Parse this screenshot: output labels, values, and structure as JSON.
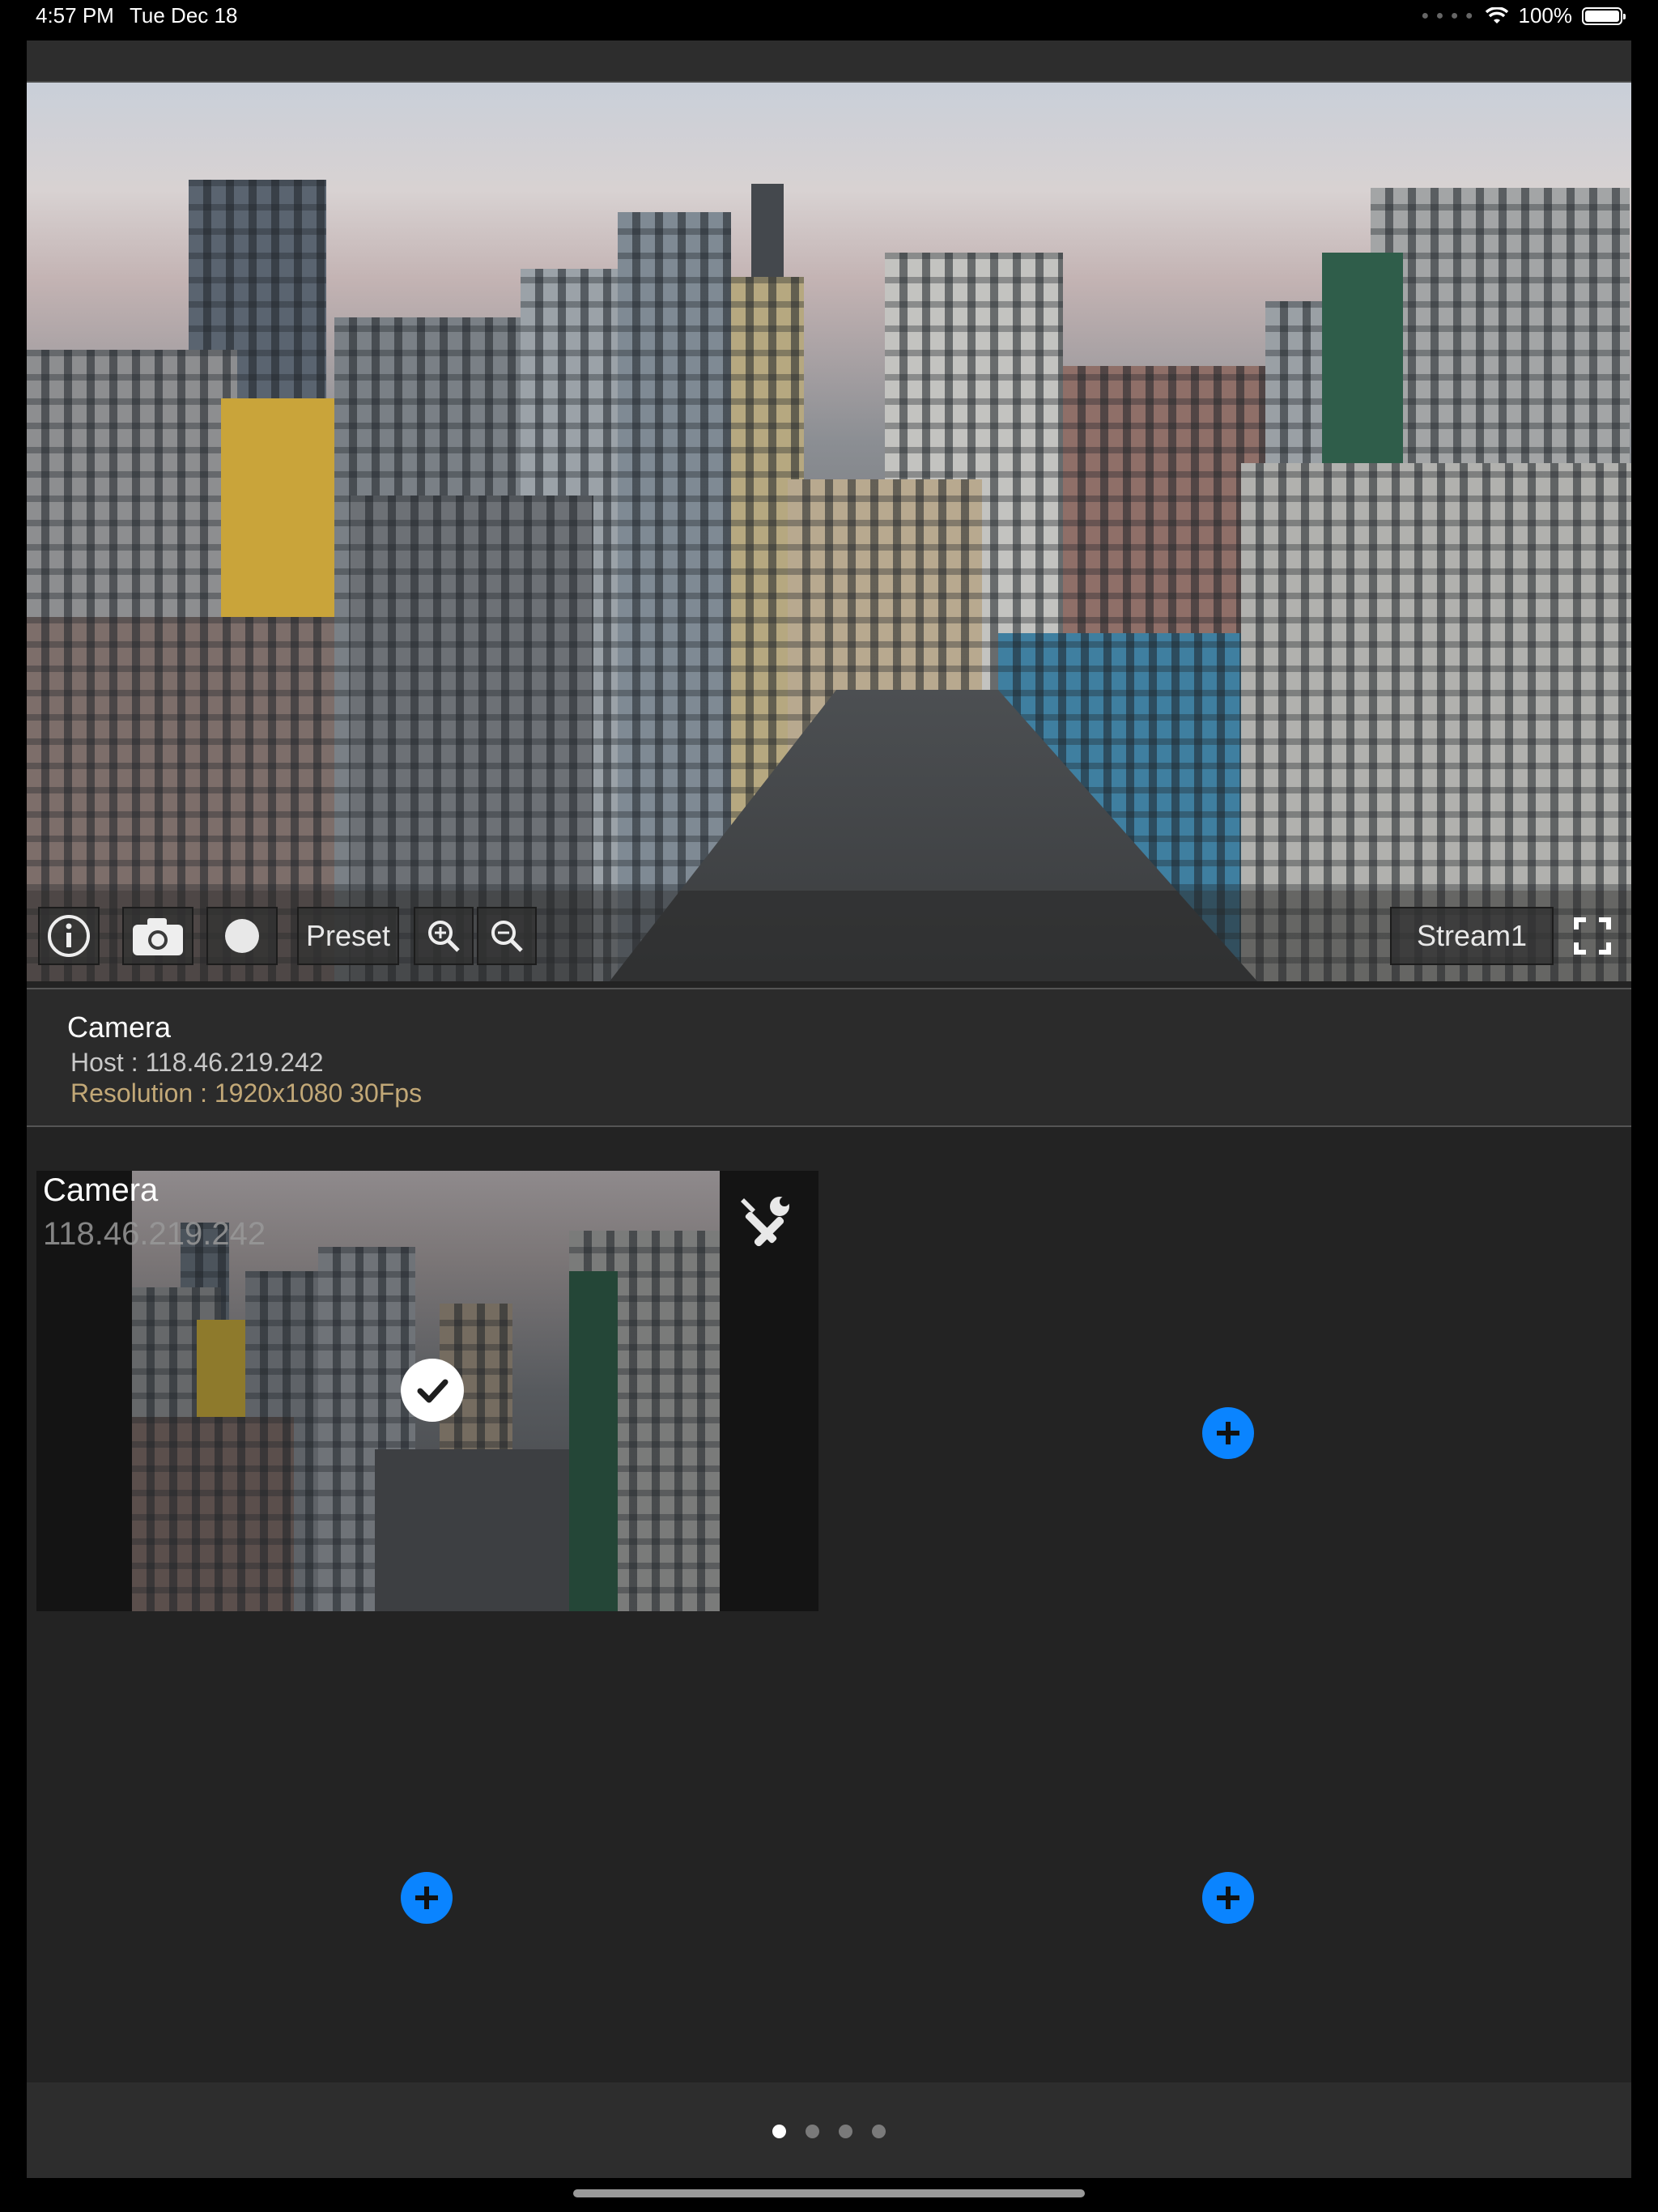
{
  "status_bar": {
    "time": "4:57 PM",
    "date": "Tue Dec 18",
    "battery": "100%",
    "icons": [
      "wifi-icon",
      "battery-icon"
    ]
  },
  "video": {
    "controls": {
      "info_icon": "info-icon",
      "snapshot_icon": "camera-icon",
      "record_icon": "record-icon",
      "preset_label": "Preset",
      "zoom_in_icon": "zoom-in-icon",
      "zoom_out_icon": "zoom-out-icon",
      "stream_label": "Stream1",
      "fullscreen_icon": "fullscreen-icon"
    }
  },
  "camera_info": {
    "name": "Camera",
    "host": "Host : 118.46.219.242",
    "resolution": "Resolution : 1920x1080  30Fps"
  },
  "grid": {
    "tile": {
      "name": "Camera",
      "host": "118.46.219.242",
      "selected": true,
      "settings_icon": "wrench-screwdriver-icon",
      "check_icon": "checkmark-icon"
    },
    "add_slots": 3,
    "add_icon": "plus-icon"
  },
  "pager": {
    "pages": 4,
    "current": 1
  },
  "colors": {
    "accent": "#0a84ff",
    "resolution_text": "#c2a877",
    "background": "#232323"
  }
}
